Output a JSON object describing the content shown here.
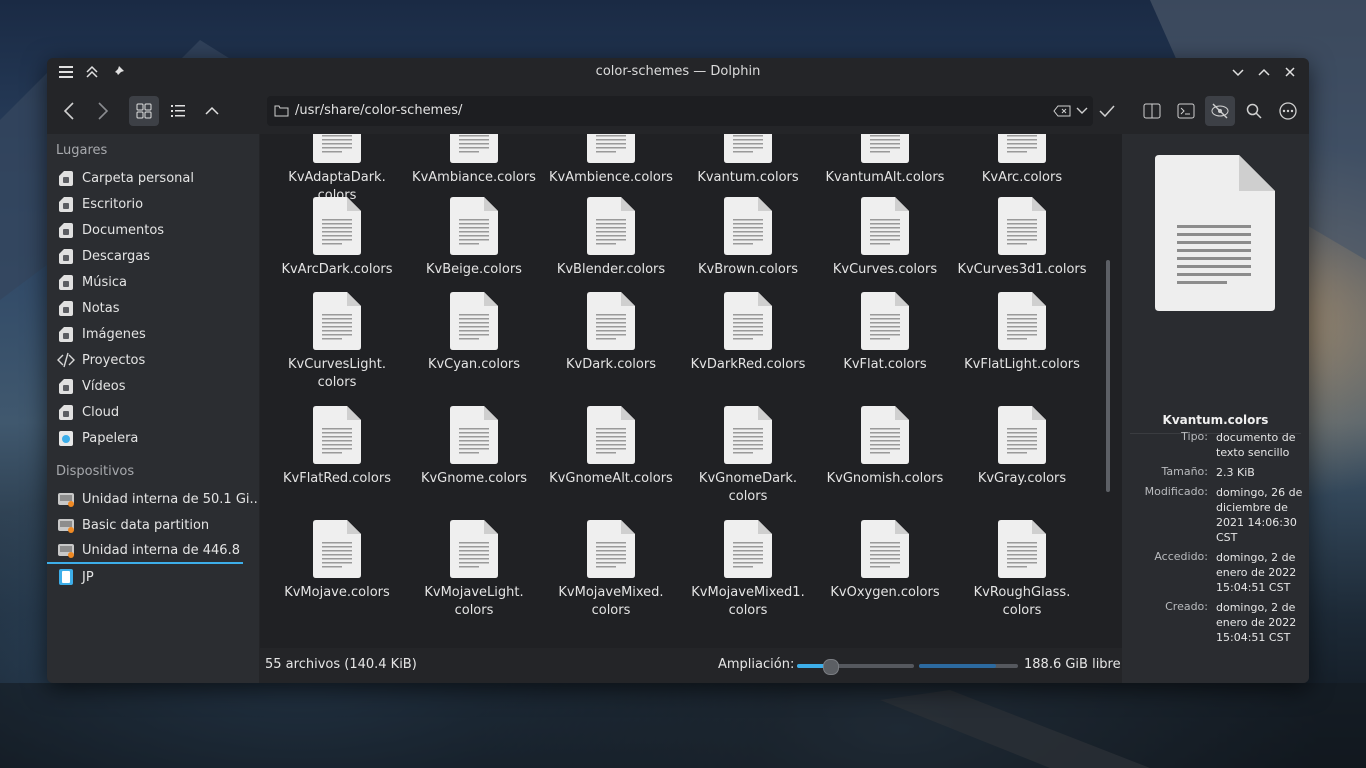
{
  "window": {
    "title": "color-schemes — Dolphin"
  },
  "location": {
    "path": "/usr/share/color-schemes/"
  },
  "sidebar": {
    "places_label": "Lugares",
    "places": [
      {
        "label": "Carpeta personal",
        "icon": "home-folder-icon"
      },
      {
        "label": "Escritorio",
        "icon": "desktop-folder-icon"
      },
      {
        "label": "Documentos",
        "icon": "documents-folder-icon"
      },
      {
        "label": "Descargas",
        "icon": "downloads-folder-icon"
      },
      {
        "label": "Música",
        "icon": "music-folder-icon"
      },
      {
        "label": "Notas",
        "icon": "notes-folder-icon"
      },
      {
        "label": "Imágenes",
        "icon": "pictures-folder-icon"
      },
      {
        "label": "Proyectos",
        "icon": "code-icon"
      },
      {
        "label": "Vídeos",
        "icon": "videos-folder-icon"
      },
      {
        "label": "Cloud",
        "icon": "cloud-folder-icon"
      },
      {
        "label": "Papelera",
        "icon": "trash-icon"
      }
    ],
    "devices_label": "Dispositivos",
    "devices": [
      {
        "label": "Unidad interna de 50.1 Gi...",
        "icon": "hard-drive-icon"
      },
      {
        "label": "Basic data partition",
        "icon": "hard-drive-icon"
      },
      {
        "label": "Unidad interna de 446.8 ...",
        "icon": "hard-drive-icon"
      },
      {
        "label": "JP",
        "icon": "usb-device-icon"
      }
    ]
  },
  "files": [
    [
      "KvAdaptaDark.\ncolors",
      "KvAmbiance.colors",
      "KvAmbience.colors",
      "Kvantum.colors",
      "KvantumAlt.colors",
      "KvArc.colors"
    ],
    [
      "KvArcDark.colors",
      "KvBeige.colors",
      "KvBlender.colors",
      "KvBrown.colors",
      "KvCurves.colors",
      "KvCurves3d1.colors"
    ],
    [
      "KvCurvesLight.\ncolors",
      "KvCyan.colors",
      "KvDark.colors",
      "KvDarkRed.colors",
      "KvFlat.colors",
      "KvFlatLight.colors"
    ],
    [
      "KvFlatRed.colors",
      "KvGnome.colors",
      "KvGnomeAlt.colors",
      "KvGnomeDark.\ncolors",
      "KvGnomish.colors",
      "KvGray.colors"
    ],
    [
      "KvMojave.colors",
      "KvMojaveLight.\ncolors",
      "KvMojaveMixed.\ncolors",
      "KvMojaveMixed1.\ncolors",
      "KvOxygen.colors",
      "KvRoughGlass.\ncolors"
    ]
  ],
  "status": {
    "count": "55 archivos (140.4 KiB)",
    "zoom_label": "Ampliación:",
    "zoom_level": 0.28,
    "free_space": "188.6 GiB libre",
    "disk_used_fraction": 0.78
  },
  "info": {
    "name": "Kvantum.colors",
    "rows": [
      {
        "key": "Tipo:",
        "value": "documento de texto sencillo"
      },
      {
        "key": "Tamaño:",
        "value": "2.3 KiB"
      },
      {
        "key": "Modificado:",
        "value": "domingo, 26 de diciembre de 2021 14:06:30 CST"
      },
      {
        "key": "Accedido:",
        "value": "domingo, 2 de enero de 2022 15:04:51 CST"
      },
      {
        "key": "Creado:",
        "value": "domingo, 2 de enero de 2022 15:04:51 CST"
      }
    ]
  },
  "colors": {
    "accent": "#3daee9",
    "window_bg": "#242528",
    "view_bg": "#202124"
  }
}
